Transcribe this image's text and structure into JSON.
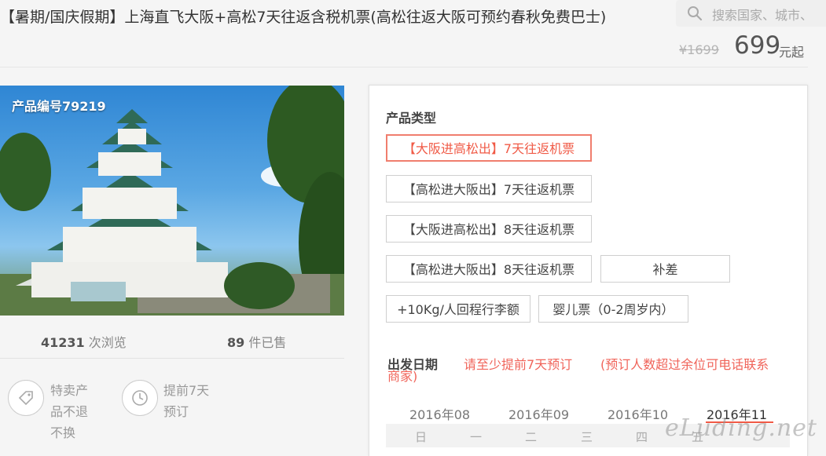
{
  "header": {
    "title": "【暑期/国庆假期】上海直飞大阪+高松7天往返含税机票(高松往返大阪可预约春秋免费巴士)",
    "search_placeholder": "搜索国家、城市、",
    "old_price": "¥1699",
    "price": "699",
    "price_unit": "元起"
  },
  "product": {
    "number_label": "产品编号79219",
    "views_count": "41231",
    "views_label": "次浏览",
    "sold_count": "89",
    "sold_label": "件已售",
    "features": [
      {
        "icon": "tag-icon",
        "lines": [
          "特卖产",
          "品不退",
          "不换"
        ]
      },
      {
        "icon": "clock-icon",
        "lines": [
          "提前7天",
          "预订"
        ]
      }
    ]
  },
  "options": {
    "type_label": "产品类型",
    "items": [
      "【大阪进高松出】7天往返机票",
      "【高松进大阪出】7天往返机票",
      "【大阪进高松出】8天往返机票",
      "【高松进大阪出】8天往返机票",
      "补差",
      "+10Kg/人回程行李额",
      "婴儿票（0-2周岁内）"
    ],
    "selected_index": 0
  },
  "date": {
    "label": "出发日期",
    "notice_advance": "请至少提前7天预订",
    "notice_contact": "(预订人数超过余位可电话联系",
    "notice_contact_2": "商家)",
    "months": [
      "2016年08",
      "2016年09",
      "2016年10",
      "2016年11"
    ],
    "active_month": "2016年11",
    "weekdays": [
      "日",
      "一",
      "二",
      "三",
      "四",
      "五"
    ]
  },
  "watermark": "eLuding.net",
  "colors": {
    "accent": "#f05a46",
    "background": "#f5f5f5",
    "panel": "#ffffff"
  }
}
